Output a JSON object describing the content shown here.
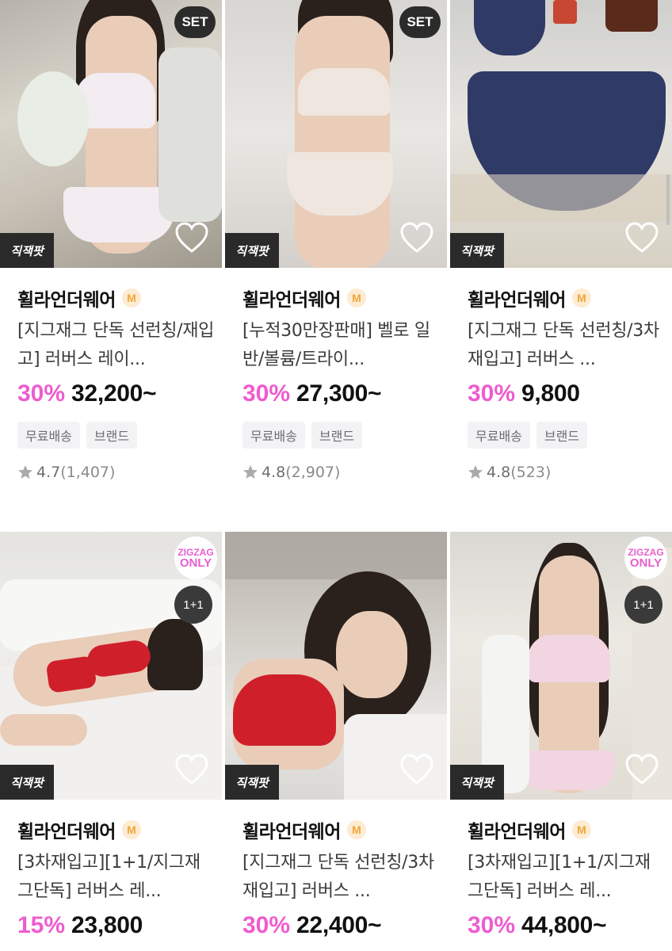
{
  "common": {
    "store_name": "휠라언더웨어",
    "store_grade": "M",
    "jikjaek_label": "직잭팟"
  },
  "products": [
    {
      "title": "[지그재그 단독 선런칭/재입고] 러버스 레이...",
      "discount": "30%",
      "price": "32,200~",
      "tags": [
        "무료배송",
        "브랜드"
      ],
      "rating": "4.7",
      "review_count": "(1,407)",
      "badge": "SET"
    },
    {
      "title": "[누적30만장판매] 벨로 일반/볼륨/트라이...",
      "discount": "30%",
      "price": "27,300~",
      "tags": [
        "무료배송",
        "브랜드"
      ],
      "rating": "4.8",
      "review_count": "(2,907)",
      "badge": "SET"
    },
    {
      "title": "[지그재그 단독 선런칭/3차재입고] 러버스 ...",
      "discount": "30%",
      "price": "9,800",
      "tags": [
        "무료배송",
        "브랜드"
      ],
      "rating": "4.8",
      "review_count": "(523)",
      "badge": ""
    },
    {
      "title": "[3차재입고][1+1/지그재그단독] 러버스 레...",
      "discount": "15%",
      "price": "23,800",
      "badge_zigzag_line1": "ZIGZAG",
      "badge_zigzag_line2": "ONLY",
      "badge_deal": "1+1"
    },
    {
      "title": "[지그재그 단독 선런칭/3차재입고] 러버스 ...",
      "discount": "30%",
      "price": "22,400~"
    },
    {
      "title": "[3차재입고][1+1/지그재그단독] 러버스 레...",
      "discount": "30%",
      "price": "44,800~",
      "badge_zigzag_line1": "ZIGZAG",
      "badge_zigzag_line2": "ONLY",
      "badge_deal": "1+1"
    }
  ],
  "colors": {
    "discount": "#ee5ccf",
    "zigzag_badge": "#e85fce",
    "grade_badge": "#f0a73b"
  }
}
